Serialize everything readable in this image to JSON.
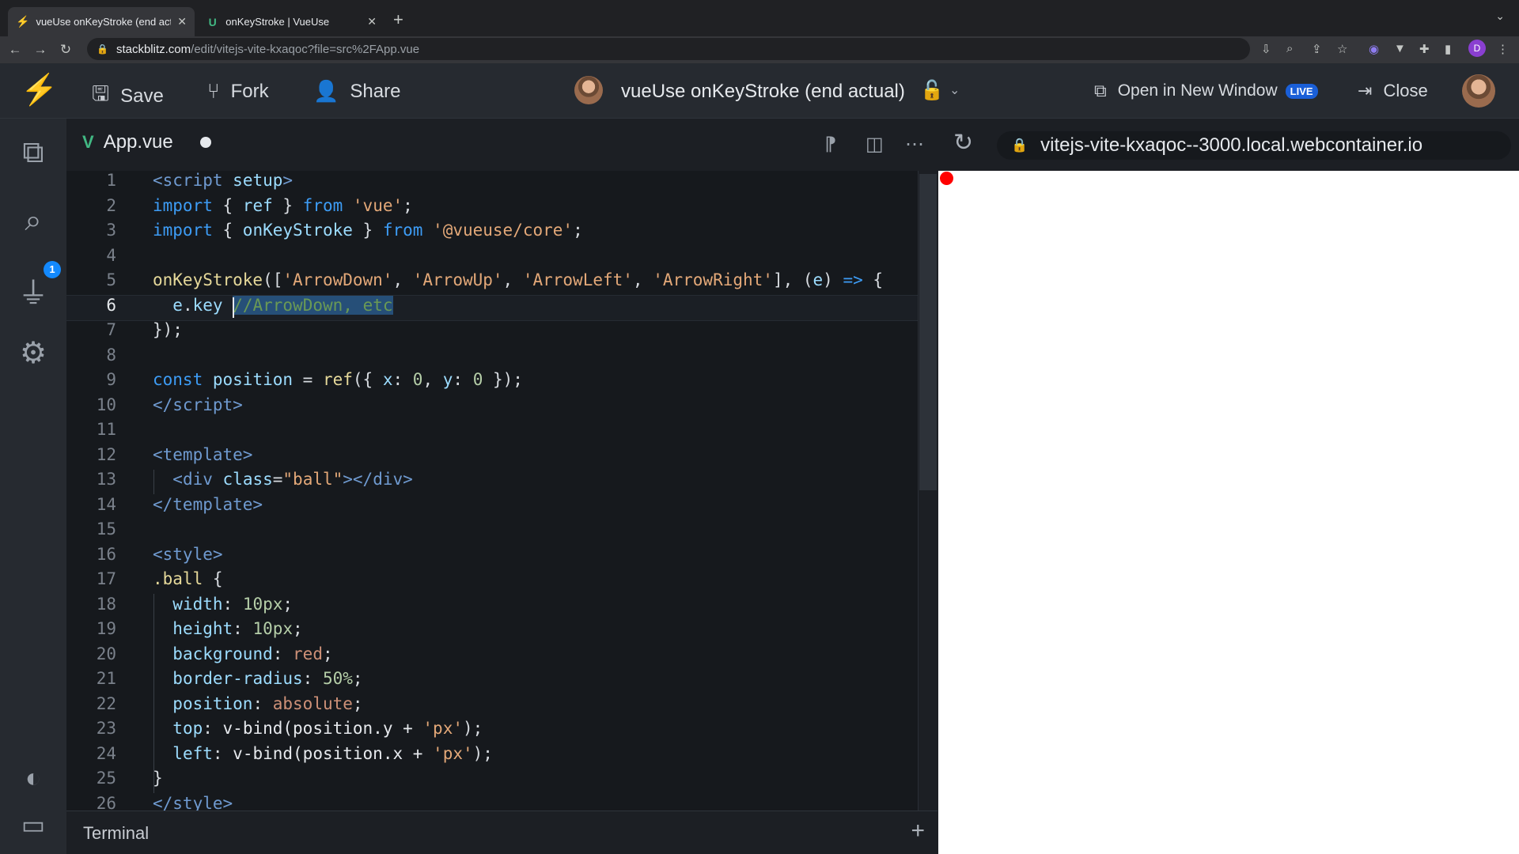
{
  "browser": {
    "tabs": [
      {
        "title": "vueUse onKeyStroke (end actu",
        "favicon": "bolt-icon"
      },
      {
        "title": "onKeyStroke | VueUse",
        "favicon": "vueuse-icon"
      }
    ],
    "url_host": "stackblitz.com",
    "url_path": "/edit/vitejs-vite-kxaqoc?file=src%2FApp.vue",
    "profile_letter": "D"
  },
  "header": {
    "save_label": "Save",
    "fork_label": "Fork",
    "share_label": "Share",
    "project_title": "vueUse onKeyStroke (end actual)",
    "open_window_label": "Open in New Window",
    "live_badge": "LIVE",
    "close_label": "Close"
  },
  "sidebar": {
    "badge_count": "1"
  },
  "editor": {
    "file_tab": "App.vue",
    "cursor_line": 6,
    "line_numbers": [
      "1",
      "2",
      "3",
      "4",
      "5",
      "6",
      "7",
      "8",
      "9",
      "10",
      "11",
      "12",
      "13",
      "14",
      "15",
      "16",
      "17",
      "18",
      "19",
      "20",
      "21",
      "22",
      "23",
      "24",
      "25",
      "26"
    ]
  },
  "terminal": {
    "label": "Terminal"
  },
  "preview": {
    "url": "vitejs-vite-kxaqoc--3000.local.webcontainer.io"
  },
  "colors": {
    "accent": "#1389fd",
    "vue_green": "#41b883",
    "ball": "#ff0000",
    "live_badge": "#1a5fd8"
  }
}
